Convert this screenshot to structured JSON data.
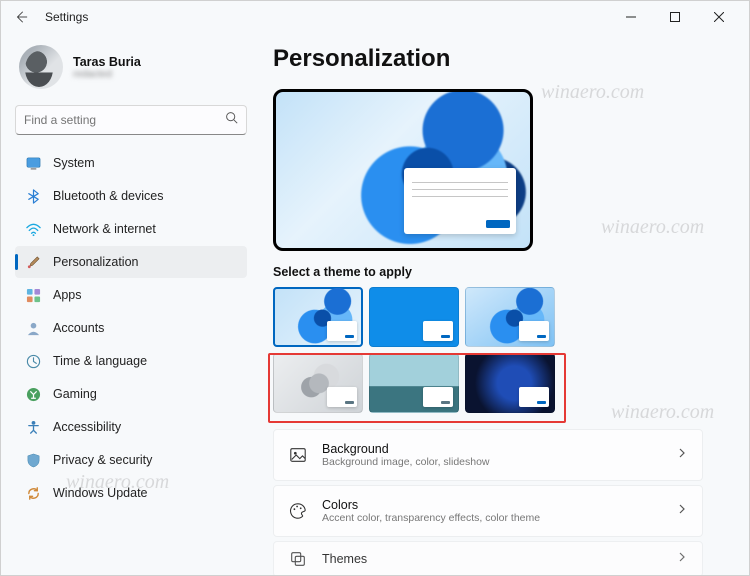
{
  "titlebar": {
    "title": "Settings"
  },
  "profile": {
    "name": "Taras Buria",
    "sub": "redacted"
  },
  "search": {
    "placeholder": "Find a setting"
  },
  "nav": {
    "system": "System",
    "bluetooth": "Bluetooth & devices",
    "network": "Network & internet",
    "personalization": "Personalization",
    "apps": "Apps",
    "accounts": "Accounts",
    "time": "Time & language",
    "gaming": "Gaming",
    "accessibility": "Accessibility",
    "privacy": "Privacy & security",
    "update": "Windows Update"
  },
  "page": {
    "title": "Personalization",
    "theme_label": "Select a theme to apply"
  },
  "rows": {
    "background": {
      "title": "Background",
      "sub": "Background image, color, slideshow"
    },
    "colors": {
      "title": "Colors",
      "sub": "Accent color, transparency effects, color theme"
    },
    "themes": {
      "title": "Themes"
    }
  },
  "watermark": "winaero.com"
}
